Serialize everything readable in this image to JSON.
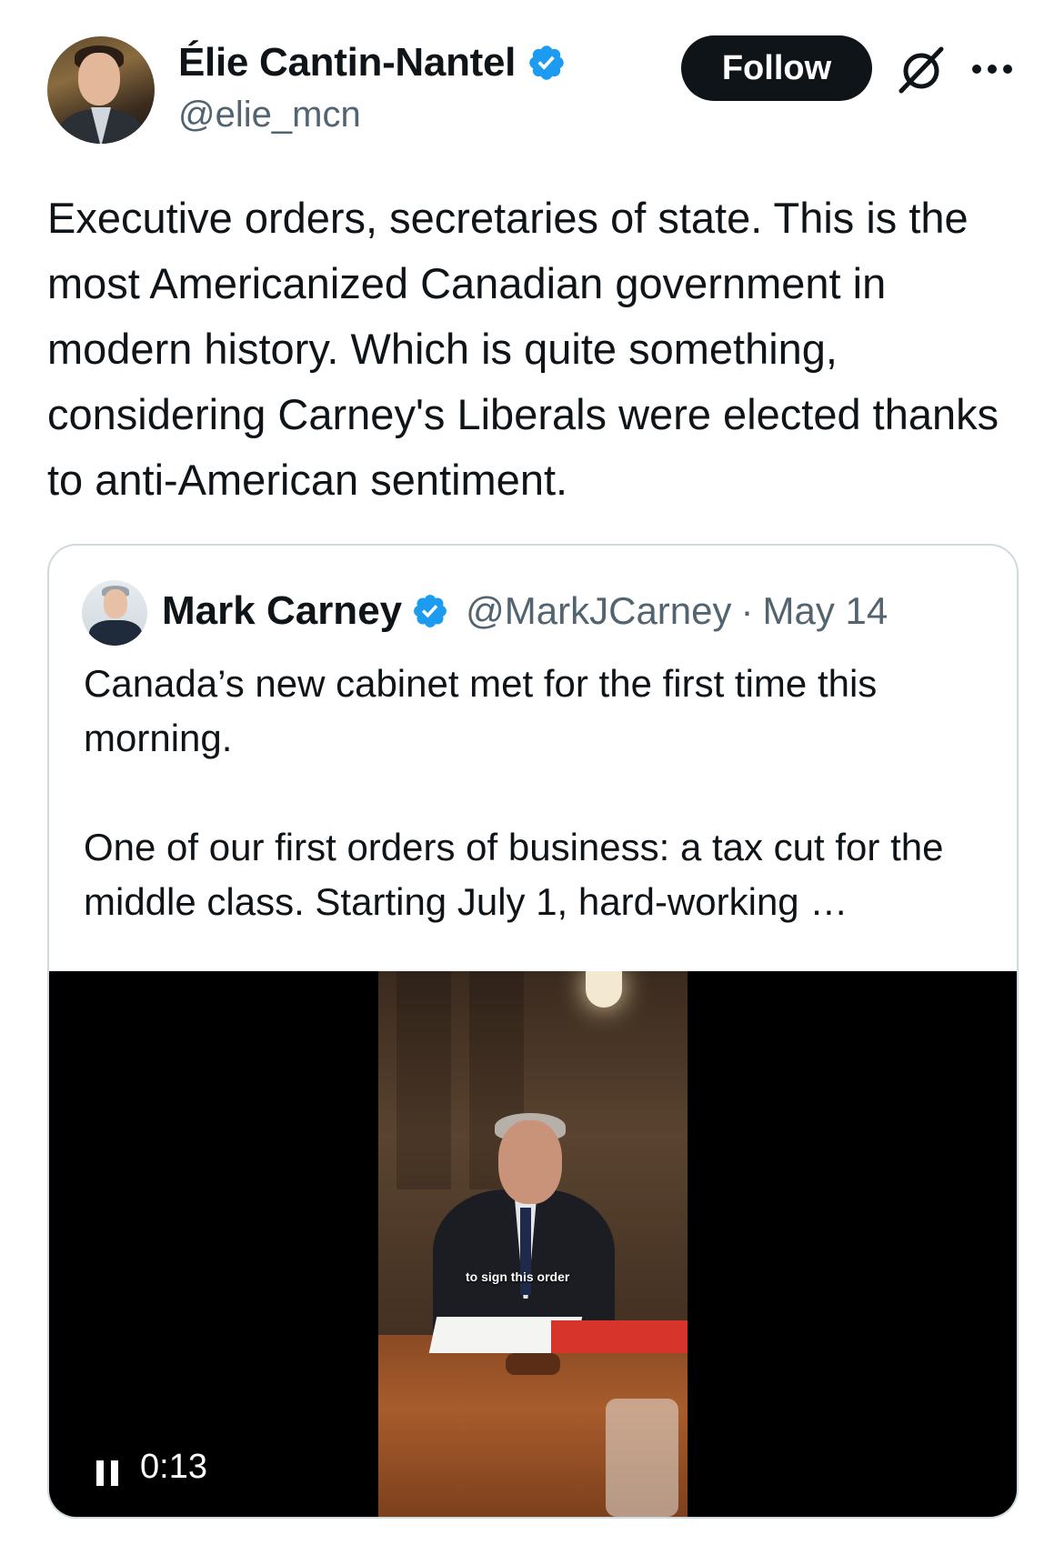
{
  "author": {
    "name": "Élie Cantin-Nantel",
    "handle": "@elie_mcn",
    "verified": true
  },
  "actions": {
    "follow_label": "Follow",
    "grok_icon": "grok-icon",
    "more_icon": "more-icon"
  },
  "tweet": {
    "text": "Executive orders, secretaries of state. This is the most Americanized Canadian government in modern history. Which is quite something, considering Carney's Liberals were elected thanks to anti-American sentiment."
  },
  "quote": {
    "name": "Mark Carney",
    "handle": "@MarkJCarney",
    "separator": "·",
    "date": "May 14",
    "verified": true,
    "paragraph1": "Canada’s new cabinet met for the first time this morning.",
    "paragraph2": "One of our first orders of business: a tax cut for the middle class. Starting July 1, hard-working …"
  },
  "video": {
    "caption": "to sign this order",
    "time": "0:13",
    "state_icon": "pause-icon"
  },
  "colors": {
    "verified_blue": "#1d9bf0",
    "text_primary": "#0f1419",
    "text_secondary": "#536471",
    "border": "#cfd9de"
  }
}
